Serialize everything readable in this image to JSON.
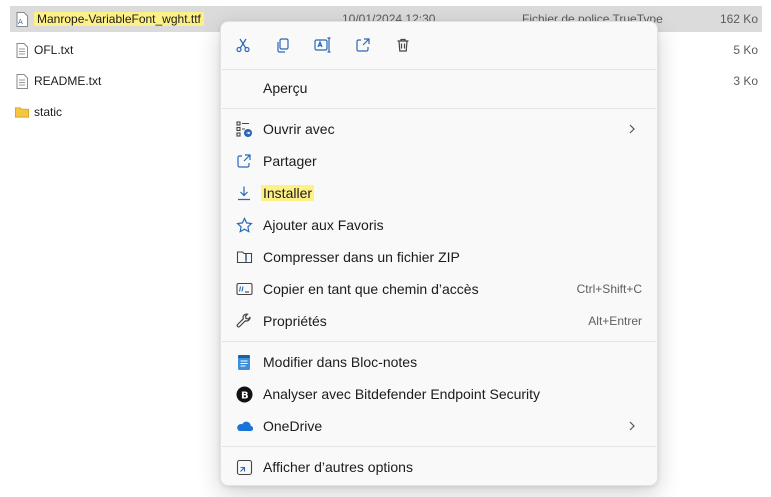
{
  "files": [
    {
      "name": "Manrope-VariableFont_wght.ttf",
      "date": "10/01/2024 12:30",
      "type": "Fichier de police TrueType",
      "size": "162 Ko",
      "icon": "font-file-icon",
      "selected": true
    },
    {
      "name": "OFL.txt",
      "size": "5 Ko",
      "icon": "text-file-icon"
    },
    {
      "name": "README.txt",
      "size": "3 Ko",
      "icon": "text-file-icon"
    },
    {
      "name": "static",
      "icon": "folder-icon"
    }
  ],
  "context_menu": {
    "toolbar": [
      {
        "name": "cut",
        "icon": "scissors-icon"
      },
      {
        "name": "copy",
        "icon": "copy-icon"
      },
      {
        "name": "rename",
        "icon": "rename-icon"
      },
      {
        "name": "share",
        "icon": "share-icon"
      },
      {
        "name": "delete",
        "icon": "trash-icon"
      }
    ],
    "items": [
      {
        "label": "Aperçu",
        "icon": ""
      },
      {
        "label": "Ouvrir avec",
        "icon": "open-with-icon",
        "submenu": true
      },
      {
        "label": "Partager",
        "icon": "share-icon"
      },
      {
        "label": "Installer",
        "icon": "download-icon",
        "highlighted": true
      },
      {
        "label": "Ajouter aux Favoris",
        "icon": "star-icon"
      },
      {
        "label": "Compresser dans un fichier ZIP",
        "icon": "zip-icon"
      },
      {
        "label": "Copier en tant que chemin d’accès",
        "icon": "copy-path-icon",
        "shortcut": "Ctrl+Shift+C"
      },
      {
        "label": "Propriétés",
        "icon": "wrench-icon",
        "shortcut": "Alt+Entrer"
      },
      {
        "label": "Modifier dans Bloc-notes",
        "icon": "notepad-icon"
      },
      {
        "label": "Analyser avec Bitdefender Endpoint Security",
        "icon": "bitdefender-icon"
      },
      {
        "label": "OneDrive",
        "icon": "onedrive-icon",
        "submenu": true
      },
      {
        "label": "Afficher d’autres options",
        "icon": "more-options-icon"
      }
    ]
  },
  "colors": {
    "selection": "#dbdbdb",
    "highlight": "#fdf087",
    "accent": "#2b67b5",
    "menu_bg": "#f9f9f9"
  }
}
